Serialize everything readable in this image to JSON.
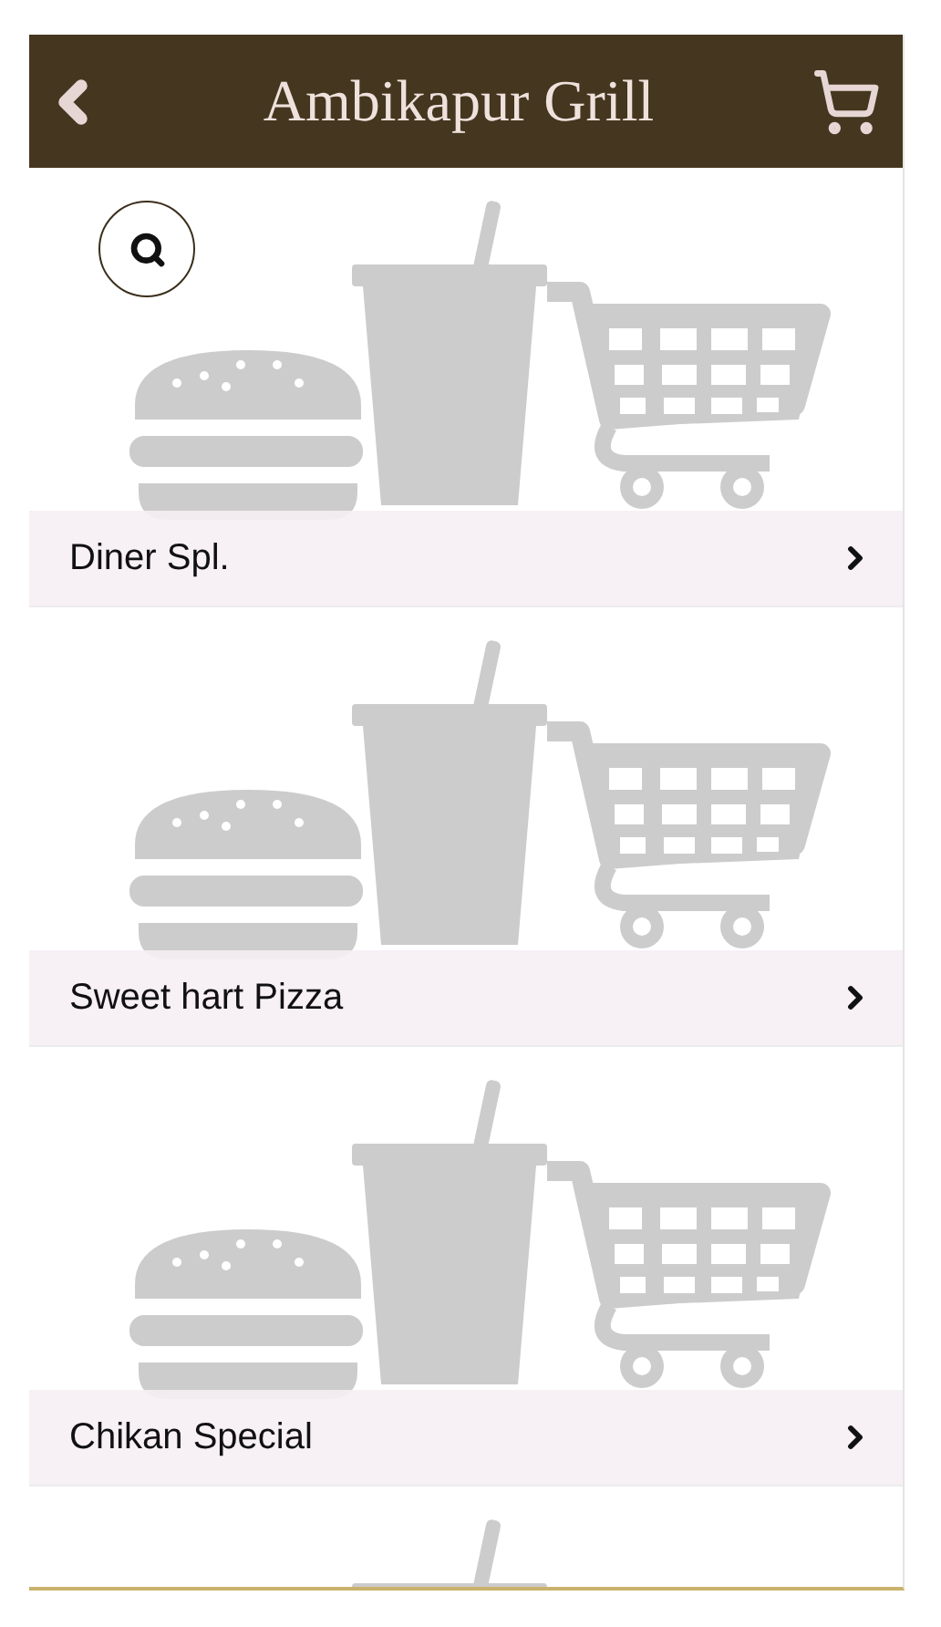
{
  "header": {
    "title": "Ambikapur Grill"
  },
  "categories": [
    {
      "kind": "card",
      "name": "Diner Spl."
    },
    {
      "kind": "card",
      "name": "Sweet hart Pizza"
    },
    {
      "kind": "card",
      "name": "Chikan Special"
    },
    {
      "kind": "cut"
    }
  ]
}
